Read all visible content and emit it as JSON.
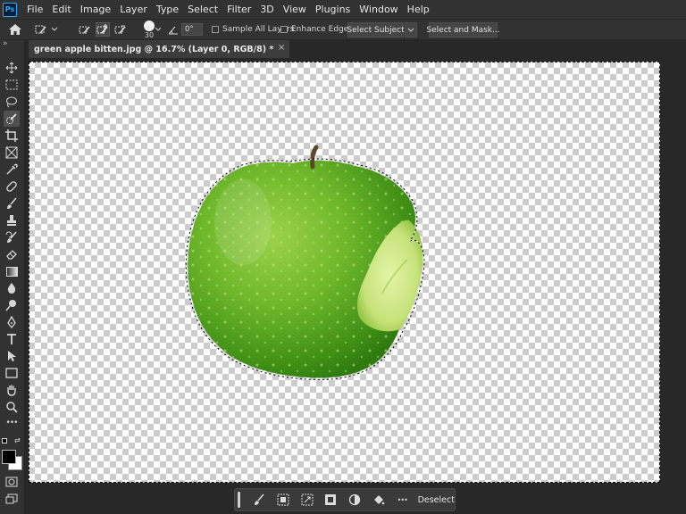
{
  "app": {
    "logo_text": "Ps"
  },
  "menu": [
    "File",
    "Edit",
    "Image",
    "Layer",
    "Type",
    "Select",
    "Filter",
    "3D",
    "View",
    "Plugins",
    "Window",
    "Help"
  ],
  "options_bar": {
    "brush_size": "30",
    "angle": "0°",
    "sample_all_layers": "Sample All Layers",
    "enhance_edge": "Enhance Edge",
    "select_subject": "Select Subject",
    "select_and_mask": "Select and Mask..."
  },
  "document": {
    "tab_title": "green apple bitten.jpg @ 16.7% (Layer 0, RGB/8) *",
    "close_glyph": "×"
  },
  "taskbar": {
    "deselect_label": "Deselect",
    "more_glyph": "•••"
  },
  "toolbar": {
    "more_glyph": "•••",
    "collapse_glyph": "»"
  },
  "colors": {
    "foreground": "#000000",
    "background": "#ffffff",
    "apple_green": "#6fb72b",
    "ui_panel": "#323232",
    "ui_bg": "#282828"
  }
}
